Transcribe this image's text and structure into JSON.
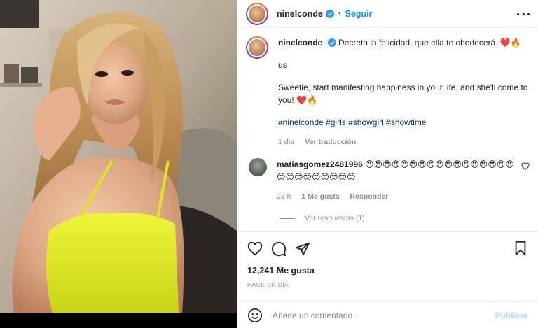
{
  "post": {
    "username": "ninelconde",
    "follow_label": "Seguir",
    "separator": "•"
  },
  "caption": {
    "username": "ninelconde",
    "text_es": "Decreta la felicidad, que ella te obedecerá. ❤️🔥",
    "lang_marker": "us",
    "text_en": "Sweetie, start manifesting happiness in your life, and she'll come to you! ❤️🔥",
    "hashtags": [
      "#ninelconde",
      "#girls",
      "#showgirl",
      "#showtime"
    ],
    "time": "1 día",
    "translate_label": "Ver traducción"
  },
  "comment": {
    "username": "matiasgomez2481996",
    "text": "😍😍😍😍😍😍😍😍😍😍😍😍😍😍😍😍😍😍😍😍😍😍😍😍😍😍",
    "time": "23 h",
    "likes": "1 Me gusta",
    "reply_label": "Responder",
    "view_replies": "Ver respuestas (1)"
  },
  "actions": {
    "likes": "12,241 Me gusta",
    "ago": "HACE UN DÍA"
  },
  "add_comment": {
    "placeholder": "Añade un comentario...",
    "publish_label": "Publicar"
  },
  "colors": {
    "link": "#0095f6",
    "hashtag": "#00376b",
    "muted": "#8e8e8e",
    "publish_disabled": "#b2dffc",
    "dress": "#e6f02a"
  },
  "icons": [
    "verified-icon",
    "more-options-icon",
    "heart-icon",
    "comment-icon",
    "share-icon",
    "bookmark-icon",
    "emoji-icon"
  ]
}
